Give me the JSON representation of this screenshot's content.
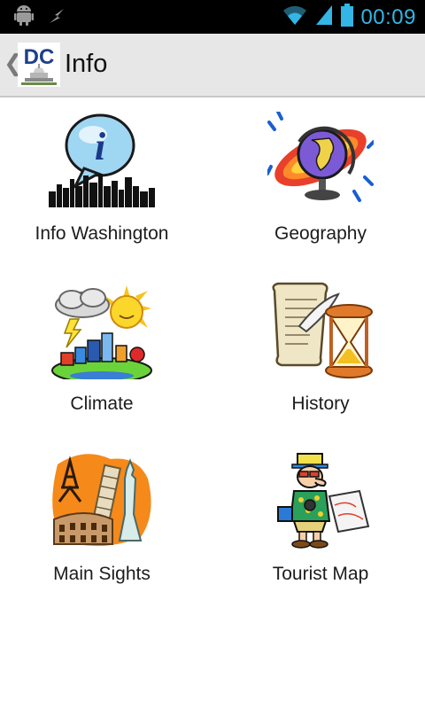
{
  "status_bar": {
    "time": "00:09",
    "accent": "#33b5e5",
    "icons": [
      "android-icon",
      "usb-debug-icon",
      "wifi-icon",
      "signal-icon",
      "battery-icon"
    ]
  },
  "action_bar": {
    "title": "Info",
    "logo_text": "DC",
    "up_icon": "chevron-left-icon"
  },
  "menu": {
    "items": [
      {
        "label": "Info Washington",
        "icon": "info-bubble-icon"
      },
      {
        "label": "Geography",
        "icon": "globe-icon"
      },
      {
        "label": "Climate",
        "icon": "weather-icon"
      },
      {
        "label": "History",
        "icon": "scroll-hourglass-icon"
      },
      {
        "label": "Main Sights",
        "icon": "landmarks-icon"
      },
      {
        "label": "Tourist Map",
        "icon": "tourist-icon"
      }
    ]
  }
}
